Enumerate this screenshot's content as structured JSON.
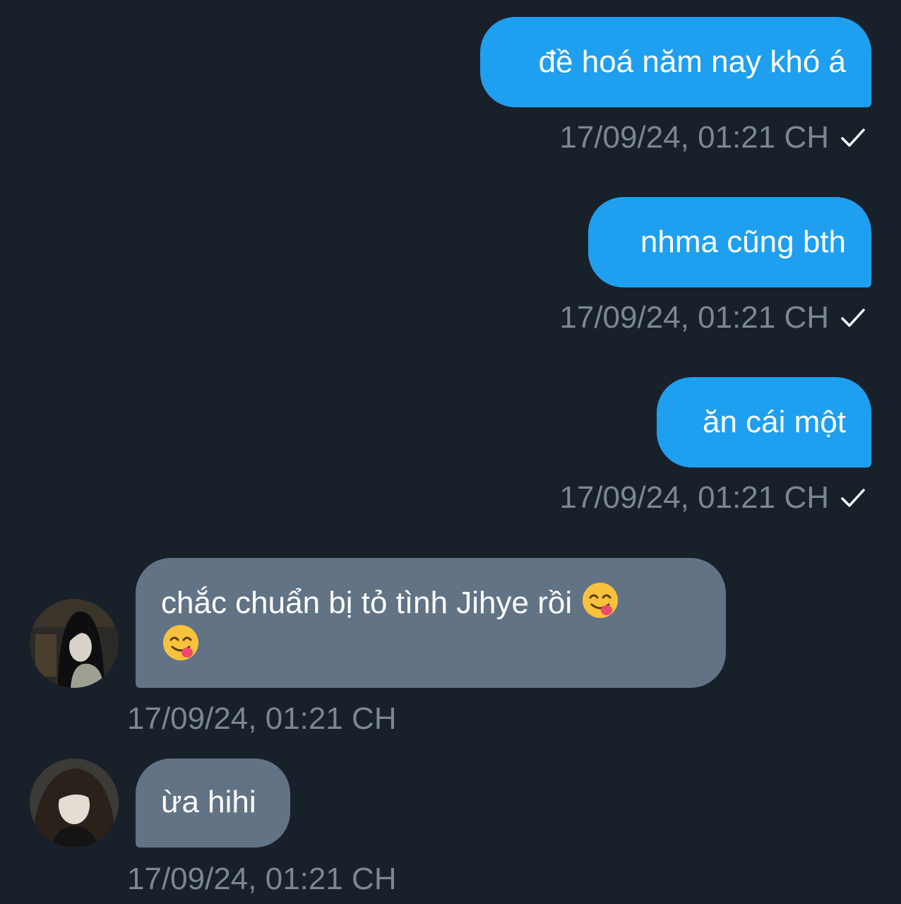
{
  "theme": {
    "background": "#18202a",
    "outgoing_bubble": "#1e9ff0",
    "incoming_bubble": "#637386",
    "timestamp_color": "#7b8794"
  },
  "messages": [
    {
      "direction": "outgoing",
      "text": "đề hoá năm nay khó á",
      "time": "17/09/24, 01:21 CH",
      "status_icon": "check-icon"
    },
    {
      "direction": "outgoing",
      "text": "nhma cũng bth",
      "time": "17/09/24, 01:21 CH",
      "status_icon": "check-icon"
    },
    {
      "direction": "outgoing",
      "text": "ăn cái một",
      "time": "17/09/24, 01:21 CH",
      "status_icon": "check-icon"
    },
    {
      "direction": "incoming",
      "text": "chắc chuẩn bị tỏ tình Jihye rồi",
      "emoji": [
        "yum-emoji-icon",
        "yum-emoji-icon"
      ],
      "avatar": "avatar-photo",
      "time": "17/09/24, 01:21 CH"
    },
    {
      "direction": "incoming",
      "text": "ừa hihi",
      "avatar": "avatar-photo",
      "time": "17/09/24, 01:21 CH"
    }
  ]
}
